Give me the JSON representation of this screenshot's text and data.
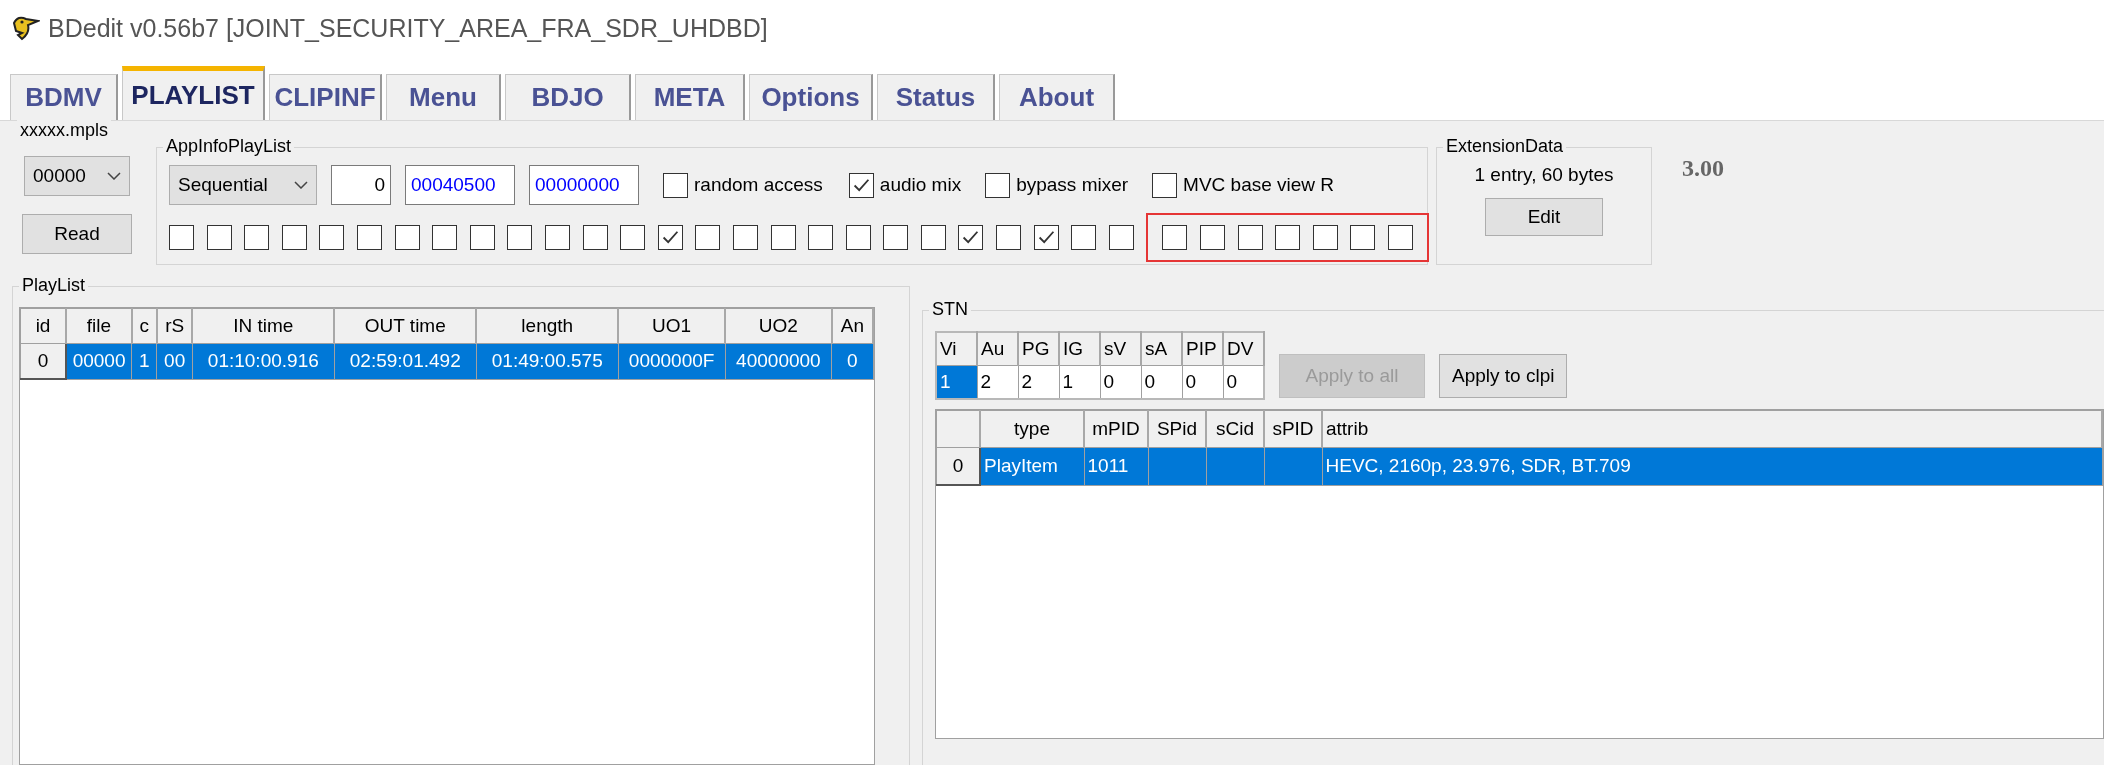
{
  "window": {
    "title": "BDedit v0.56b7 [JOINT_SECURITY_AREA_FRA_SDR_UHDBD]"
  },
  "tabs": [
    {
      "label": "BDMV",
      "selected": false
    },
    {
      "label": "PLAYLIST",
      "selected": true
    },
    {
      "label": "CLIPINF",
      "selected": false
    },
    {
      "label": "Menu",
      "selected": false
    },
    {
      "label": "BDJO",
      "selected": false
    },
    {
      "label": "META",
      "selected": false
    },
    {
      "label": "Options",
      "selected": false
    },
    {
      "label": "Status",
      "selected": false
    },
    {
      "label": "About",
      "selected": false
    }
  ],
  "mpls_group": {
    "title": "xxxxx.mpls",
    "dropdown": "00000",
    "button": "Read"
  },
  "app_info": {
    "title": "AppInfoPlayList",
    "playback_type": "Sequential",
    "fields": [
      {
        "value": "0",
        "kind": "number"
      },
      {
        "value": "00040500",
        "kind": "hex"
      },
      {
        "value": "00000000",
        "kind": "hex"
      }
    ],
    "options": [
      {
        "label": "random access",
        "checked": false
      },
      {
        "label": "audio mix",
        "checked": true
      },
      {
        "label": "bypass mixer",
        "checked": false
      },
      {
        "label": "MVC base view R",
        "checked": false
      }
    ],
    "flag_groups": [
      {
        "highlighted": false,
        "flags": [
          {
            "checked": false
          },
          {
            "checked": false
          },
          {
            "checked": false
          },
          {
            "checked": false
          },
          {
            "checked": false
          },
          {
            "checked": false
          },
          {
            "checked": false
          },
          {
            "checked": false
          },
          {
            "checked": false
          },
          {
            "checked": false
          },
          {
            "checked": false
          },
          {
            "checked": false
          },
          {
            "checked": false
          },
          {
            "checked": true
          },
          {
            "checked": false
          },
          {
            "checked": false
          },
          {
            "checked": false
          },
          {
            "checked": false
          },
          {
            "checked": false
          },
          {
            "checked": false
          },
          {
            "checked": false
          },
          {
            "checked": true
          },
          {
            "checked": false
          },
          {
            "checked": true
          },
          {
            "checked": false
          },
          {
            "checked": false
          }
        ]
      },
      {
        "highlighted": true,
        "flags": [
          {
            "checked": false
          },
          {
            "checked": false
          },
          {
            "checked": false
          },
          {
            "checked": false
          },
          {
            "checked": false
          },
          {
            "checked": false
          },
          {
            "checked": false
          }
        ]
      }
    ]
  },
  "extension_data": {
    "title": "ExtensionData",
    "summary": "1 entry, 60 bytes",
    "button": "Edit"
  },
  "version": "3.00",
  "playlist": {
    "title": "PlayList",
    "columns": [
      "id",
      "file",
      "c",
      "rS",
      "IN time",
      "OUT time",
      "length",
      "UO1",
      "UO2",
      "An"
    ],
    "rows": [
      {
        "selected": true,
        "cells": [
          "0",
          "00000",
          "1",
          "00",
          "01:10:00.916",
          "02:59:01.492",
          "01:49:00.575",
          "0000000F",
          "40000000",
          "0"
        ]
      }
    ]
  },
  "stn": {
    "title": "STN",
    "counts": {
      "columns": [
        "Vi",
        "Au",
        "PG",
        "IG",
        "sV",
        "sA",
        "PIP",
        "DV"
      ],
      "values": [
        {
          "value": "1",
          "selected": true
        },
        {
          "value": "2",
          "selected": false
        },
        {
          "value": "2",
          "selected": false
        },
        {
          "value": "1",
          "selected": false
        },
        {
          "value": "0",
          "selected": false
        },
        {
          "value": "0",
          "selected": false
        },
        {
          "value": "0",
          "selected": false
        },
        {
          "value": "0",
          "selected": false
        }
      ]
    },
    "buttons": [
      {
        "label": "Apply to all",
        "disabled": true
      },
      {
        "label": "Apply to clpi",
        "disabled": false
      }
    ],
    "streams": {
      "columns": [
        "",
        "type",
        "mPID",
        "SPid",
        "sCid",
        "sPID",
        "attrib"
      ],
      "rows": [
        {
          "selected": true,
          "cells": [
            "0",
            "PlayItem",
            "1011",
            "",
            "",
            "",
            "HEVC, 2160p, 23.976, SDR, BT.709"
          ]
        }
      ]
    }
  }
}
